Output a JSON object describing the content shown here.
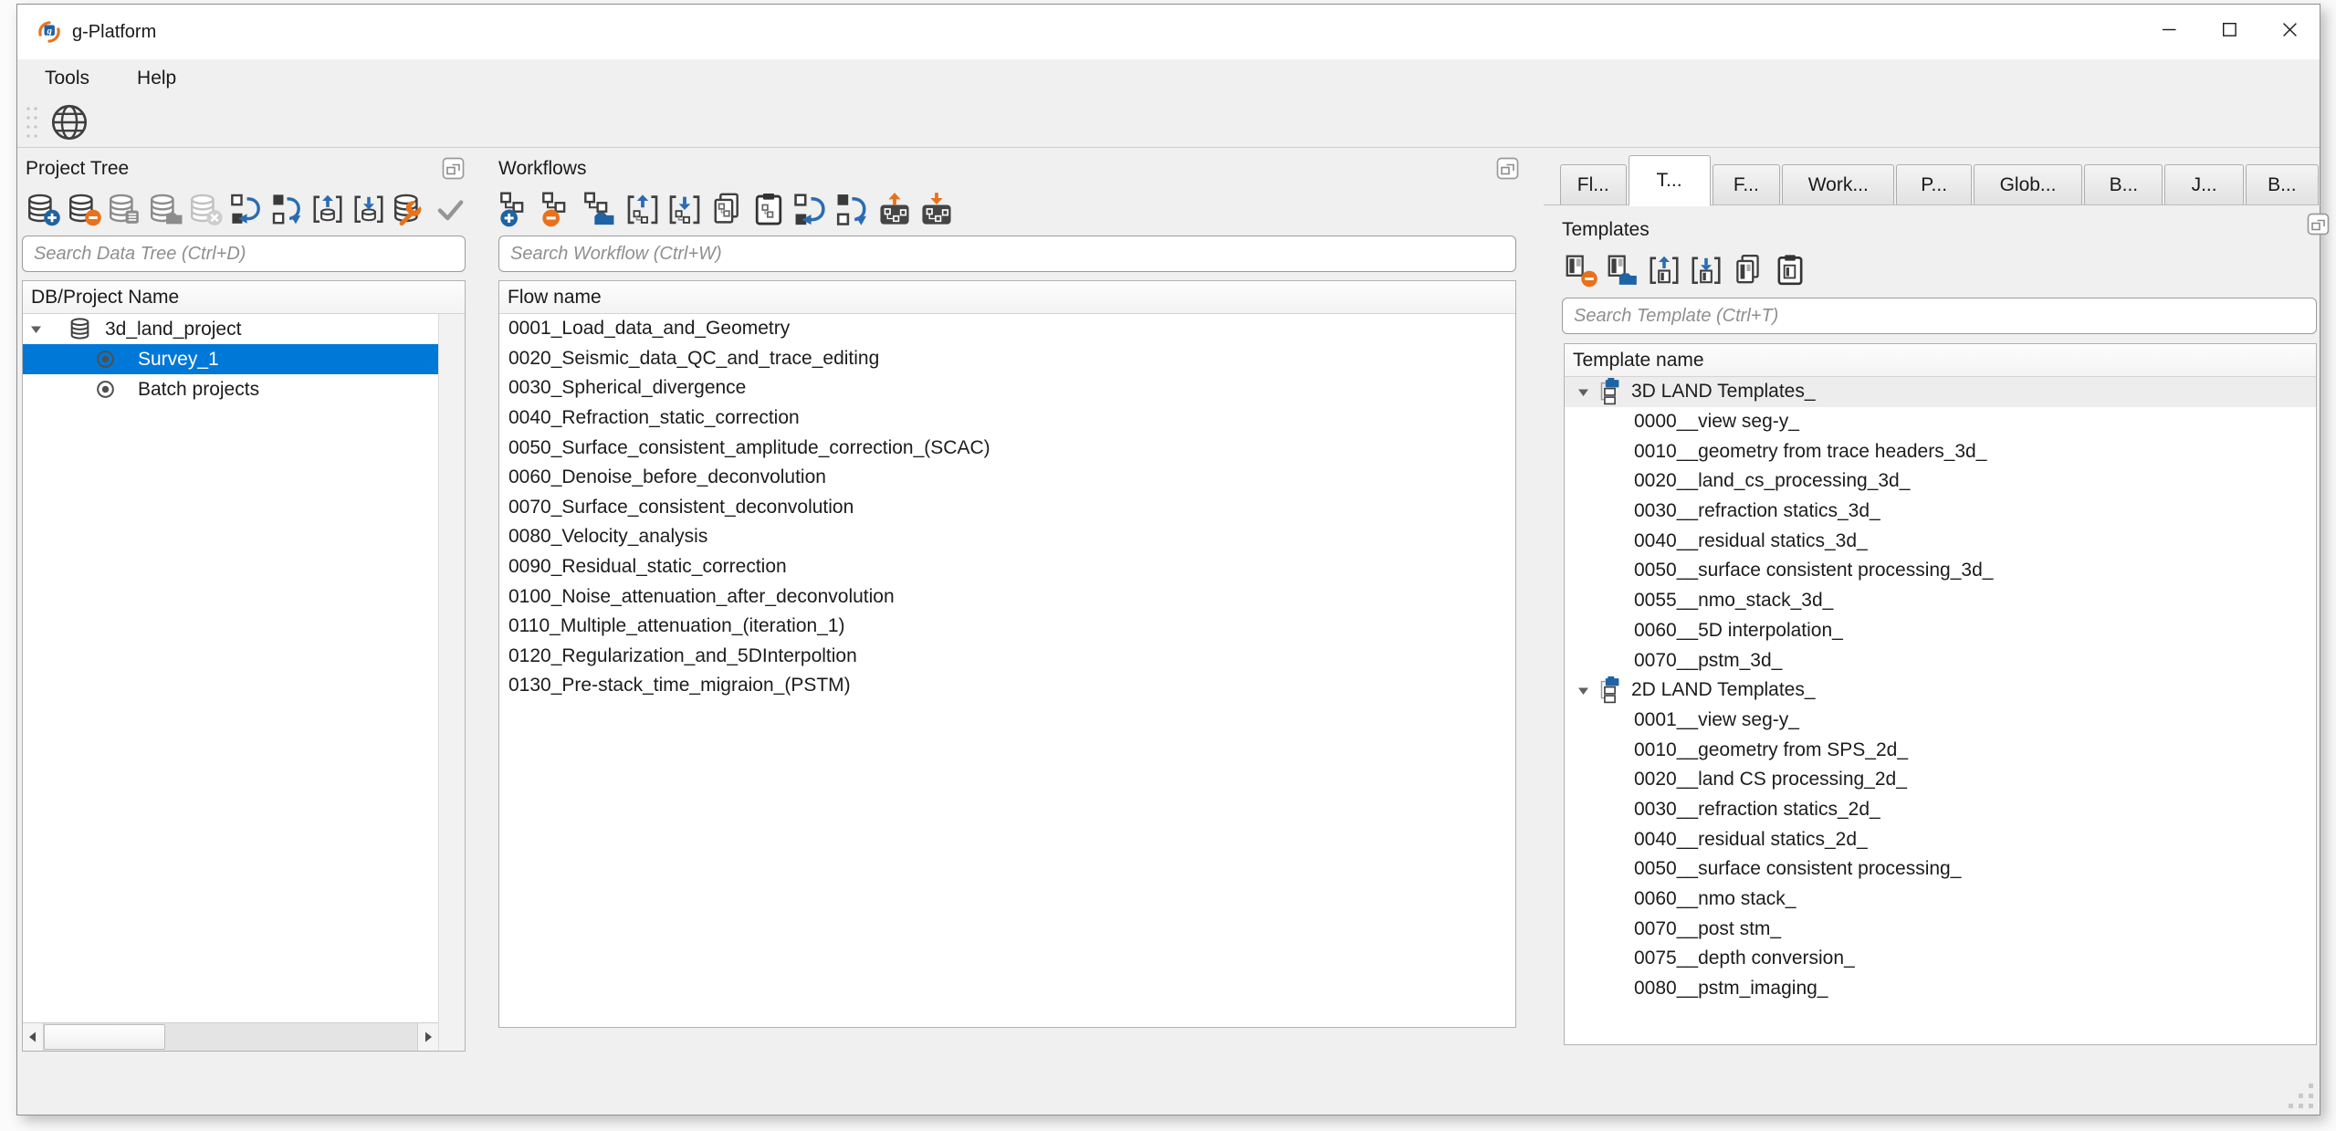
{
  "window": {
    "title": "g-Platform"
  },
  "menu": {
    "items": [
      "Tools",
      "Help"
    ]
  },
  "main_toolbar": {
    "icons": [
      "globe-icon"
    ]
  },
  "window_controls": {
    "minimize": "minimize-button",
    "maximize": "maximize-button",
    "close": "close-button"
  },
  "colors": {
    "selection": "#0078d7",
    "accent_blue": "#1f63a4",
    "accent_orange": "#e8721c",
    "panel_bg": "#f0f0f0"
  },
  "project_panel": {
    "title": "Project Tree",
    "toolbar_icons": [
      "database-add-icon",
      "database-remove-icon",
      "database-list-icon",
      "database-copy-icon",
      "database-clear-icon",
      "undo-icon",
      "redo-icon",
      "database-export-icon",
      "database-import-icon",
      "database-wrench-icon",
      "check-icon"
    ],
    "search": {
      "placeholder": "Search Data Tree (Ctrl+D)"
    },
    "tree": {
      "header": "DB/Project Name",
      "items": [
        {
          "label": "3d_land_project",
          "level": 0,
          "icon": "database",
          "expanded": true,
          "selected": false
        },
        {
          "label": "Survey_1",
          "level": 1,
          "icon": "radio",
          "selected": true
        },
        {
          "label": "Batch projects",
          "level": 1,
          "icon": "radio",
          "selected": false
        }
      ]
    }
  },
  "workflows_panel": {
    "title": "Workflows",
    "toolbar_icons": [
      "workflow-add-icon",
      "workflow-remove-icon",
      "workflow-open-icon",
      "workflow-export-icon",
      "workflow-import-icon",
      "workflow-copy-icon",
      "workflow-paste-icon",
      "undo-icon",
      "redo-icon",
      "workflow-export-run-icon",
      "workflow-import-run-icon"
    ],
    "search": {
      "placeholder": "Search Workflow (Ctrl+W)"
    },
    "list": {
      "header": "Flow name",
      "items": [
        "0001_Load_data_and_Geometry",
        "0020_Seismic_data_QC_and_trace_editing",
        "0030_Spherical_divergence",
        "0040_Refraction_static_correction",
        "0050_Surface_consistent_amplitude_correction_(SCAC)",
        "0060_Denoise_before_deconvolution",
        "0070_Surface_consistent_deconvolution",
        "0080_Velocity_analysis",
        "0090_Residual_static_correction",
        "0100_Noise_attenuation_after_deconvolution",
        "0110_Multiple_attenuation_(iteration_1)",
        "0120_Regularization_and_5DInterpoltion",
        "0130_Pre-stack_time_migraion_(PSTM)"
      ]
    }
  },
  "right_panel": {
    "tabs": [
      {
        "label": "Fl...",
        "active": false
      },
      {
        "label": "T...",
        "active": true
      },
      {
        "label": "F...",
        "active": false
      },
      {
        "label": "Work...",
        "active": false
      },
      {
        "label": "P...",
        "active": false
      },
      {
        "label": "Glob...",
        "active": false
      },
      {
        "label": "B...",
        "active": false
      },
      {
        "label": "J...",
        "active": false
      },
      {
        "label": "B...",
        "active": false
      }
    ],
    "templates": {
      "title": "Templates",
      "toolbar_icons": [
        "template-remove-icon",
        "template-open-icon",
        "template-export-icon",
        "template-import-icon",
        "template-copy-icon",
        "template-paste-icon"
      ],
      "search": {
        "placeholder": "Search Template (Ctrl+T)"
      },
      "tree": {
        "header": "Template name",
        "groups": [
          {
            "label": "3D LAND Templates_",
            "current": true,
            "children": [
              "0000__view seg-y_",
              "0010__geometry from trace headers_3d_",
              "0020__land_cs_processing_3d_",
              "0030__refraction statics_3d_",
              "0040__residual statics_3d_",
              "0050__surface consistent processing_3d_",
              "0055__nmo_stack_3d_",
              "0060__5D interpolation_",
              "0070__pstm_3d_"
            ]
          },
          {
            "label": "2D LAND Templates_",
            "current": false,
            "children": [
              "0001__view seg-y_",
              "0010__geometry from SPS_2d_",
              "0020__land CS processing_2d_",
              "0030__refraction statics_2d_",
              "0040__residual statics_2d_",
              "0050__surface consistent processing_",
              "0060__nmo stack_",
              "0070__post stm_",
              "0075__depth conversion_",
              "0080__pstm_imaging_"
            ]
          }
        ]
      }
    }
  }
}
